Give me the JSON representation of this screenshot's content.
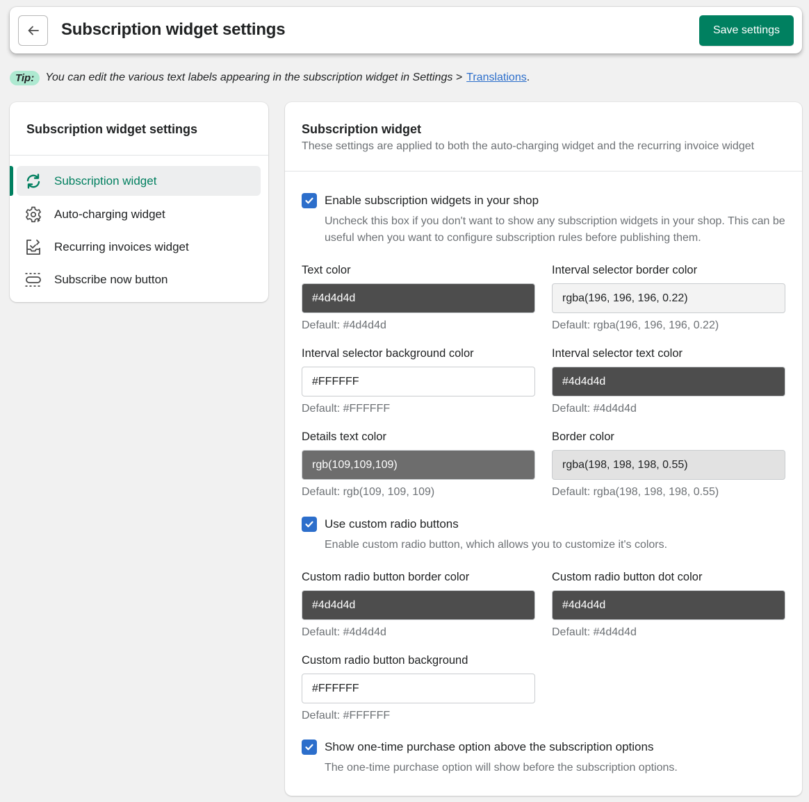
{
  "header": {
    "title": "Subscription widget settings",
    "save_label": "Save settings"
  },
  "tip": {
    "badge": "Tip:",
    "text": "You can edit the various text labels appearing in the subscription widget in Settings >",
    "link": "Translations",
    "suffix": "."
  },
  "sidebar": {
    "title": "Subscription widget settings",
    "items": [
      {
        "label": "Subscription widget",
        "icon": "refresh-icon",
        "active": true
      },
      {
        "label": "Auto-charging widget",
        "icon": "gear-icon",
        "active": false
      },
      {
        "label": "Recurring invoices widget",
        "icon": "invoice-icon",
        "active": false
      },
      {
        "label": "Subscribe now button",
        "icon": "button-icon",
        "active": false
      }
    ]
  },
  "main": {
    "title": "Subscription widget",
    "subtitle": "These settings are applied to both the auto-charging widget and the recurring invoice widget",
    "enable": {
      "label": "Enable subscription widgets in your shop",
      "checked": true,
      "help": "Uncheck this box if you don't want to show any subscription widgets in your shop. This can be useful when you want to configure subscription rules before publishing them."
    },
    "fields": {
      "text_color": {
        "label": "Text color",
        "value": "#4d4d4d",
        "default": "Default: #4d4d4d",
        "bg": "#4d4d4d",
        "fg": "#ffffff"
      },
      "interval_border": {
        "label": "Interval selector border color",
        "value": "rgba(196, 196, 196, 0.22)",
        "default": "Default: rgba(196, 196, 196, 0.22)",
        "bg": "#f3f3f3",
        "fg": "#202223"
      },
      "interval_bg": {
        "label": "Interval selector background color",
        "value": "#FFFFFF",
        "default": "Default: #FFFFFF",
        "bg": "#ffffff",
        "fg": "#202223"
      },
      "interval_text": {
        "label": "Interval selector text color",
        "value": "#4d4d4d",
        "default": "Default: #4d4d4d",
        "bg": "#4d4d4d",
        "fg": "#ffffff"
      },
      "details_text": {
        "label": "Details text color",
        "value": "rgb(109,109,109)",
        "default": "Default: rgb(109, 109, 109)",
        "bg": "#6d6d6d",
        "fg": "#ffffff"
      },
      "border_color": {
        "label": "Border color",
        "value": "rgba(198, 198, 198, 0.55)",
        "default": "Default: rgba(198, 198, 198, 0.55)",
        "bg": "#e2e2e2",
        "fg": "#202223"
      },
      "radio_border": {
        "label": "Custom radio button border color",
        "value": "#4d4d4d",
        "default": "Default: #4d4d4d",
        "bg": "#4d4d4d",
        "fg": "#ffffff"
      },
      "radio_dot": {
        "label": "Custom radio button dot color",
        "value": "#4d4d4d",
        "default": "Default: #4d4d4d",
        "bg": "#4d4d4d",
        "fg": "#ffffff"
      },
      "radio_bg": {
        "label": "Custom radio button background",
        "value": "#FFFFFF",
        "default": "Default: #FFFFFF",
        "bg": "#ffffff",
        "fg": "#202223"
      }
    },
    "custom_radio": {
      "label": "Use custom radio buttons",
      "checked": true,
      "help": "Enable custom radio button, which allows you to customize it's colors."
    },
    "one_time": {
      "label": "Show one-time purchase option above the subscription options",
      "checked": true,
      "help": "The one-time purchase option will show before the subscription options."
    }
  },
  "colors": {
    "accent": "#008060",
    "checkbox": "#2c6ecb",
    "link": "#2c6ecb",
    "tip_badge": "#aee9d1"
  }
}
